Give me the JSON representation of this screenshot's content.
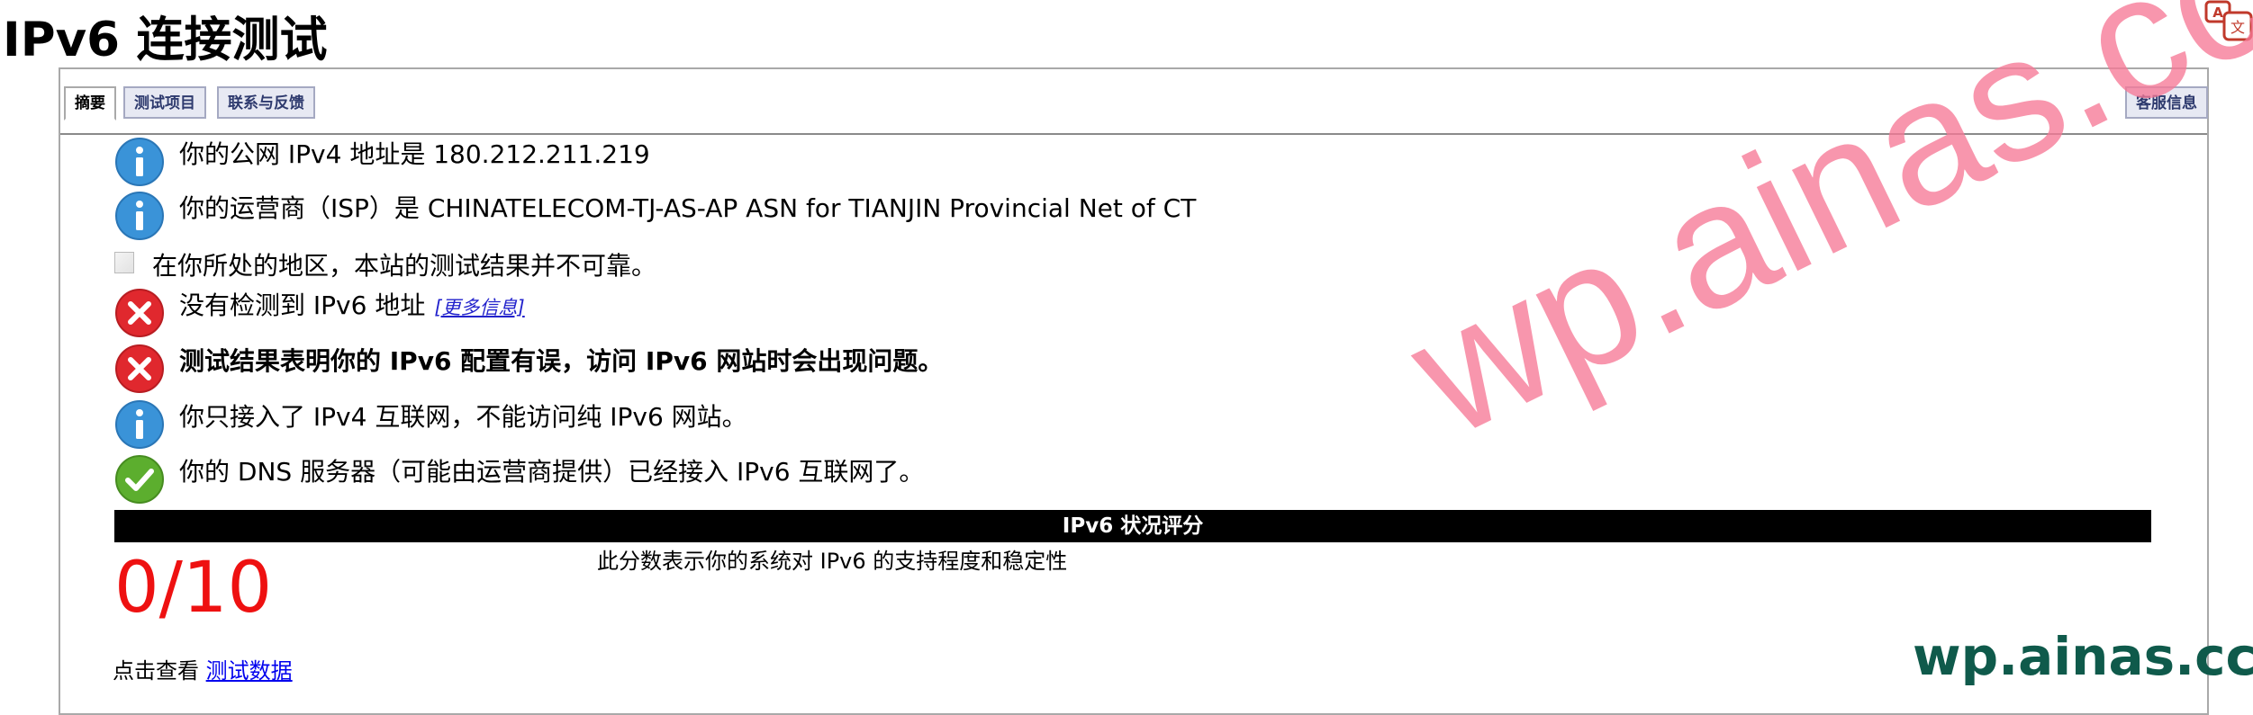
{
  "page": {
    "title": "IPv6 连接测试"
  },
  "tabs": [
    {
      "label": "摘要",
      "active": true
    },
    {
      "label": "测试项目",
      "active": false
    },
    {
      "label": "联系与反馈",
      "active": false
    },
    {
      "label": "客服信息",
      "active": false
    }
  ],
  "results": [
    {
      "icon": "info",
      "text": "你的公网 IPv4 地址是 180.212.211.219"
    },
    {
      "icon": "info",
      "text": "你的运营商（ISP）是 CHINATELECOM-TJ-AS-AP ASN for TIANJIN Provincial Net of CT"
    },
    {
      "icon": "broken-image",
      "text": "在你所处的地区，本站的测试结果并不可靠。"
    },
    {
      "icon": "error",
      "text": "没有检测到 IPv6 地址",
      "link": "[更多信息]"
    },
    {
      "icon": "error",
      "text": "测试结果表明你的 IPv6 配置有误，访问 IPv6 网站时会出现问题。",
      "bold": true
    },
    {
      "icon": "info",
      "text": "你只接入了 IPv4 互联网，不能访问纯 IPv6 网站。"
    },
    {
      "icon": "success",
      "text": "你的 DNS 服务器（可能由运营商提供）已经接入 IPv6 互联网了。"
    }
  ],
  "score": {
    "header": "IPv6 状况评分",
    "value": "0/10",
    "description": "此分数表示你的系统对 IPv6 的支持程度和稳定性"
  },
  "footer": {
    "prefix": "点击查看 ",
    "link": "测试数据"
  },
  "watermark": {
    "large": "wp.ainas.cc",
    "small": "wp.ainas.cc"
  },
  "colors": {
    "info": "#3a93d8",
    "error": "#e0282e",
    "success": "#5cae2e",
    "score": "#ee1111"
  }
}
